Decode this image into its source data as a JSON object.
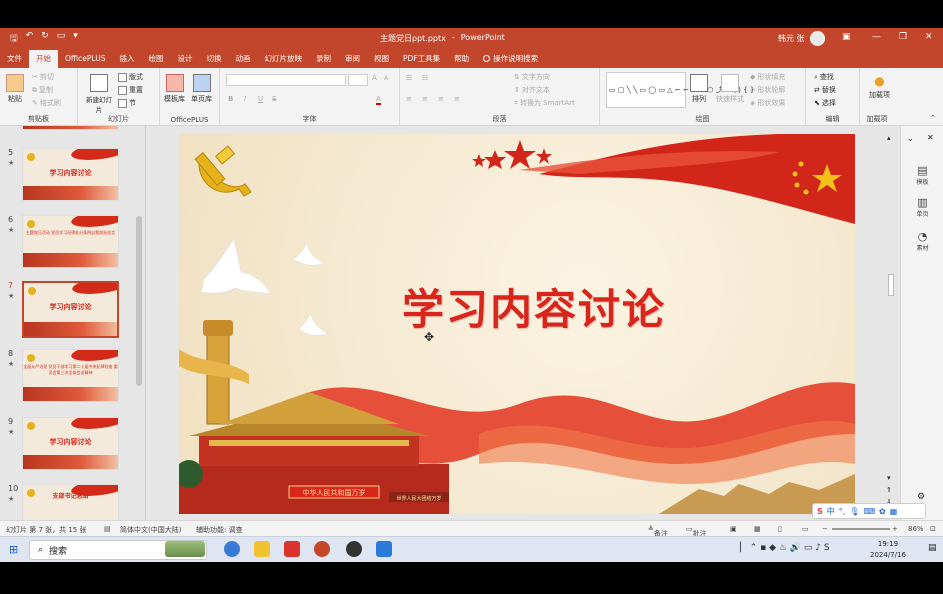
{
  "app": {
    "file_title": "主题党日ppt.pptx",
    "separator": "-",
    "app_name": "PowerPoint",
    "user_name": "韩元 张"
  },
  "colors": {
    "accent": "#c1462b",
    "slide_title": "#d9261c"
  },
  "tabs": [
    "文件",
    "开始",
    "OfficePLUS",
    "插入",
    "绘图",
    "设计",
    "切换",
    "动画",
    "幻灯片放映",
    "录制",
    "审阅",
    "视图",
    "PDF工具集",
    "帮助"
  ],
  "tell_me": "操作说明搜索",
  "ribbon": {
    "clipboard": {
      "label": "剪贴板",
      "paste": "粘贴",
      "cut": "剪切",
      "copy": "复制",
      "format_painter": "格式刷"
    },
    "slides": {
      "label": "幻灯片",
      "new_slide": "新建幻灯片",
      "layout": "版式",
      "reset": "重置",
      "section": "节"
    },
    "officeplus": {
      "label": "OfficePLUS",
      "template": "模板库",
      "single_page": "单页库"
    },
    "font": {
      "label": "字体",
      "bold": "B",
      "italic": "I",
      "underline": "U",
      "strike": "S",
      "font_color": "A",
      "grow": "A",
      "shrink": "A"
    },
    "paragraph": {
      "label": "段落",
      "text_direction": "文字方向",
      "align_text": "对齐文本",
      "smartart": "转换为 SmartArt"
    },
    "drawing": {
      "label": "绘图",
      "arrange": "排列",
      "quick_styles": "快速样式",
      "shape_fill": "形状填充",
      "shape_outline": "形状轮廓",
      "shape_effects": "形状效果"
    },
    "editing": {
      "label": "编辑",
      "find": "查找",
      "replace": "替换",
      "select": "选择"
    },
    "addins": {
      "label": "加载项",
      "addins": "加载项"
    }
  },
  "thumbnails": [
    {
      "num": "5",
      "title": "学习内容讨论",
      "selected": false
    },
    {
      "num": "6",
      "title": "主题党日活动 党员学习纪律处分条例自我剖析发言",
      "selected": false
    },
    {
      "num": "7",
      "title": "学习内容讨论",
      "selected": true
    },
    {
      "num": "8",
      "title": "全面从严治党 党员干部学习第二十届中央纪律检查 委员会第三次全体会议精神",
      "selected": false
    },
    {
      "num": "9",
      "title": "学习内容讨论",
      "selected": false
    },
    {
      "num": "10",
      "title": "支部书记总结",
      "selected": false
    }
  ],
  "slide": {
    "title": "学习内容讨论",
    "gate_banner": "中华人民共和国万岁",
    "gate_banner_right": "世界人民大团结万岁"
  },
  "right_panel": [
    "模板",
    "单页",
    "素材"
  ],
  "status": {
    "slide_info": "幻灯片 第 7 张，共 15 张",
    "language": "简体中文(中国大陆)",
    "accessibility": "辅助功能: 调查",
    "notes": "备注",
    "comments": "批注",
    "zoom": "86%"
  },
  "taskbar": {
    "search": "搜索",
    "time": "19:19",
    "date": "2024/7/16"
  },
  "ime": {
    "lang": "中"
  }
}
